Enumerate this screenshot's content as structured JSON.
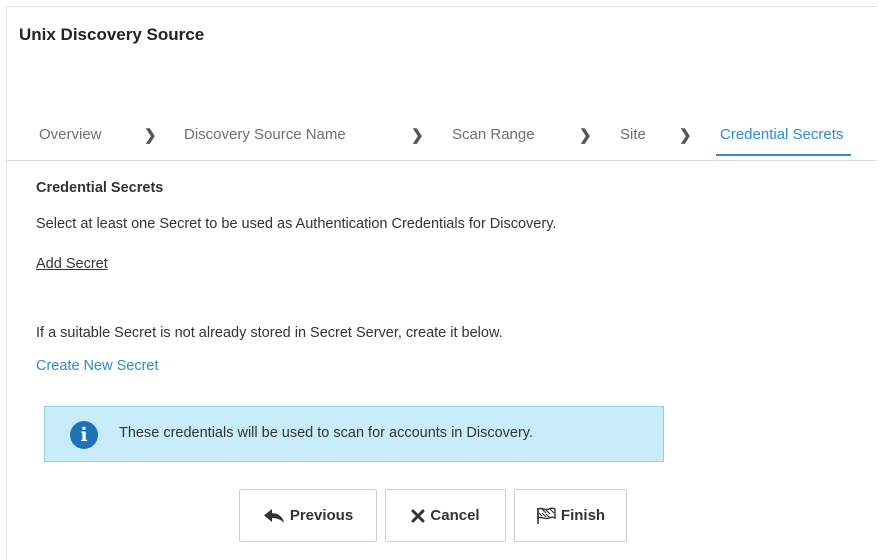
{
  "page": {
    "title": "Unix Discovery Source"
  },
  "steps": [
    {
      "label": "Overview",
      "active": false
    },
    {
      "label": "Discovery Source Name",
      "active": false
    },
    {
      "label": "Scan Range",
      "active": false
    },
    {
      "label": "Site",
      "active": false
    },
    {
      "label": "Credential Secrets",
      "active": true
    }
  ],
  "step_separator": "chevron-right-icon",
  "section": {
    "heading": "Credential Secrets",
    "description": "Select at least one Secret to be used as Authentication Credentials for Discovery.",
    "add_secret_link": "Add Secret",
    "create_hint": "If a suitable Secret is not already stored in Secret Server, create it below.",
    "create_link": "Create New Secret"
  },
  "info": {
    "icon": "info-icon",
    "text": "These credentials will be used to scan for accounts in Discovery."
  },
  "buttons": {
    "previous": {
      "label": "Previous",
      "icon": "reply-arrow-icon"
    },
    "cancel": {
      "label": "Cancel",
      "icon": "close-x-icon"
    },
    "finish": {
      "label": "Finish",
      "icon": "checkered-flag-icon"
    }
  },
  "colors": {
    "accent": "#2f8ccc",
    "info_background": "#c9ecfb",
    "info_border": "#8ecfea",
    "info_icon": "#1e73b8"
  }
}
